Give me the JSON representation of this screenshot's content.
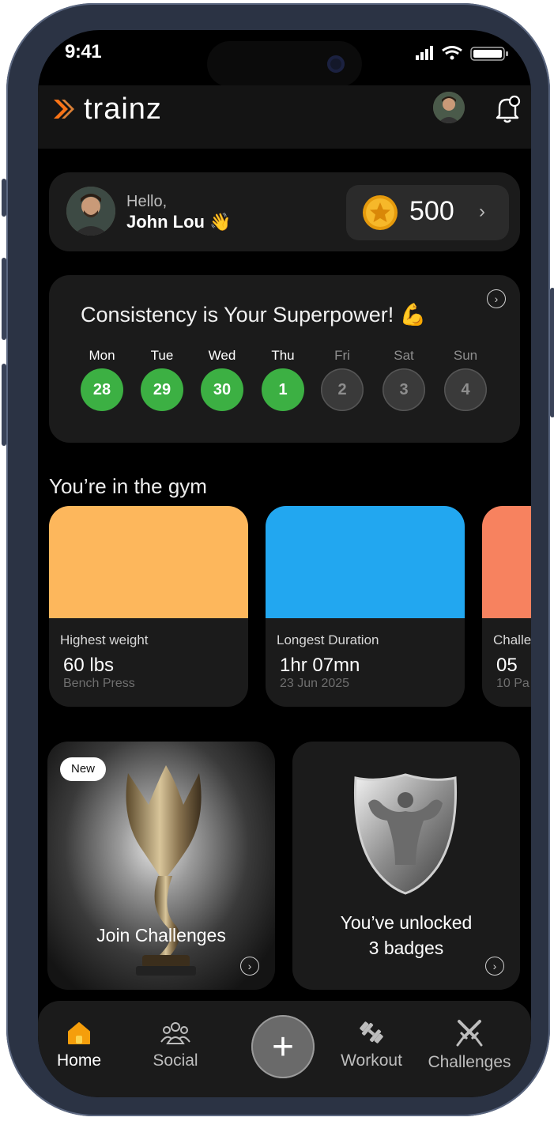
{
  "status_bar": {
    "time": "9:41"
  },
  "brand": {
    "name": "trainz",
    "accent": "#f97316"
  },
  "greeting": {
    "hello": "Hello,",
    "name": "John Lou 👋"
  },
  "coins": {
    "value": "500"
  },
  "streak": {
    "title": "Consistency is Your Superpower! 💪",
    "days": [
      {
        "label": "Mon",
        "date": "28",
        "done": true
      },
      {
        "label": "Tue",
        "date": "29",
        "done": true
      },
      {
        "label": "Wed",
        "date": "30",
        "done": true
      },
      {
        "label": "Thu",
        "date": "1",
        "done": true
      },
      {
        "label": "Fri",
        "date": "2",
        "done": false
      },
      {
        "label": "Sat",
        "date": "3",
        "done": false
      },
      {
        "label": "Sun",
        "date": "4",
        "done": false
      }
    ]
  },
  "gym": {
    "title": "You’re in the gym",
    "stats": [
      {
        "label": "Highest weight",
        "value": "60 lbs",
        "sub": "Bench Press",
        "color": "#fdb75c"
      },
      {
        "label": "Longest Duration",
        "value": "1hr 07mn",
        "sub": "23 Jun 2025",
        "color": "#22a7f0"
      },
      {
        "label": "Challe",
        "value": "05",
        "sub": "10 Pa",
        "color": "#f7825f"
      }
    ]
  },
  "promos": {
    "challenges": {
      "badge": "New",
      "label": "Join Challenges"
    },
    "badges": {
      "line1": "You’ve unlocked",
      "line2": "3 badges"
    }
  },
  "nav": {
    "home": "Home",
    "social": "Social",
    "add": "+",
    "workout": "Workout",
    "challenges": "Challenges",
    "active_color": "#f59e0b"
  }
}
